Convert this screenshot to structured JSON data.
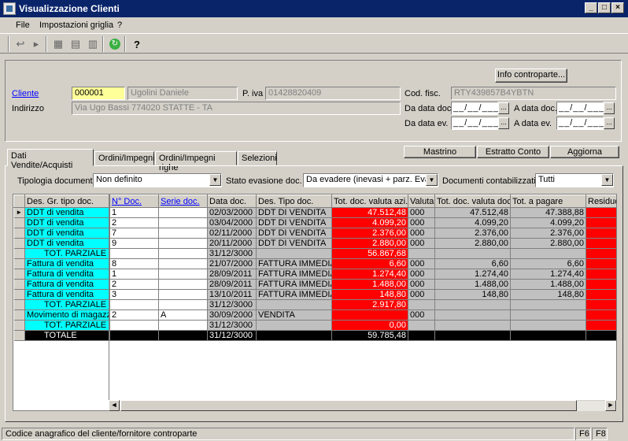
{
  "window": {
    "title": "Visualizzazione Clienti"
  },
  "menu": [
    "File",
    "Impostazioni griglia",
    "?"
  ],
  "form": {
    "cliente_label": "Cliente",
    "cliente_code": "000001",
    "cliente_name": "Ugolini Daniele",
    "piva_label": "P. iva",
    "piva_value": "01428820409",
    "codfisc_label": "Cod. fisc.",
    "codfisc_value": "RTY439857B4YBTN",
    "indirizzo_label": "Indirizzo",
    "indirizzo_value": "Via Ugo Bassi  774020  STATTE  - TA",
    "info_button": "Info controparte...",
    "da_data_doc": "Da data doc.",
    "a_data_doc": "A data doc.",
    "da_data_ev": "Da data ev.",
    "a_data_ev": "A data ev.",
    "date_placeholder": "__/__/____",
    "date_btn": "..."
  },
  "tabs": [
    "Dati Vendite/Acquisti",
    "Ordini/Impegni",
    "Ordini/Impegni righe",
    "Selezioni"
  ],
  "actions": {
    "mastrino": "Mastrino",
    "estratto": "Estratto Conto",
    "aggiorna": "Aggiorna"
  },
  "filters": {
    "tipologia_label": "Tipologia documenti",
    "tipologia_value": "Non definito",
    "stato_label": "Stato evasione doc.",
    "stato_value": "Da evadere (inevasi + parz. Evasi",
    "contab_label": "Documenti contabilizzati",
    "contab_value": "Tutti"
  },
  "grid": {
    "columns": [
      "Des. Gr. tipo doc.",
      "N° Doc.",
      "Serie doc.",
      "Data doc.",
      "Des. Tipo doc.",
      "Tot. doc. valuta azi.",
      "Valuta",
      "Tot. doc. valuta doc",
      "Tot. a pagare",
      "Residuo"
    ],
    "rows": [
      {
        "kind": "doc",
        "c": [
          "DDT di vendita",
          "1",
          "",
          "02/03/2000",
          "DDT DI VENDITA",
          "47.512,48",
          "000",
          "47.512,48",
          "47.388,88",
          ""
        ],
        "current": true
      },
      {
        "kind": "doc",
        "c": [
          "DDT di vendita",
          "2",
          "",
          "03/04/2000",
          "DDT DI VENDITA",
          "4.099,20",
          "000",
          "4.099,20",
          "4.099,20",
          ""
        ]
      },
      {
        "kind": "doc",
        "c": [
          "DDT di vendita",
          "7",
          "",
          "02/11/2000",
          "DDT DI VENDITA",
          "2.376,00",
          "000",
          "2.376,00",
          "2.376,00",
          ""
        ]
      },
      {
        "kind": "doc",
        "c": [
          "DDT di vendita",
          "9",
          "",
          "20/11/2000",
          "DDT DI VENDITA",
          "2.880,00",
          "000",
          "2.880,00",
          "2.880,00",
          ""
        ]
      },
      {
        "kind": "sub",
        "c": [
          "TOT. PARZIALE",
          "",
          "",
          "31/12/3000",
          "",
          "56.867,68",
          "",
          "",
          "",
          ""
        ]
      },
      {
        "kind": "doc",
        "c": [
          "Fattura di vendita",
          "8",
          "",
          "21/07/2000",
          "FATTURA IMMEDIA",
          "6,60",
          "000",
          "6,60",
          "6,60",
          ""
        ]
      },
      {
        "kind": "doc",
        "c": [
          "Fattura di vendita",
          "1",
          "",
          "28/09/2011",
          "FATTURA IMMEDIA",
          "1.274,40",
          "000",
          "1.274,40",
          "1.274,40",
          ""
        ]
      },
      {
        "kind": "doc",
        "c": [
          "Fattura di vendita",
          "2",
          "",
          "28/09/2011",
          "FATTURA IMMEDIA",
          "1.488,00",
          "000",
          "1.488,00",
          "1.488,00",
          ""
        ]
      },
      {
        "kind": "doc",
        "c": [
          "Fattura di vendita",
          "3",
          "",
          "13/10/2011",
          "FATTURA IMMEDIA",
          "148,80",
          "000",
          "148,80",
          "148,80",
          ""
        ]
      },
      {
        "kind": "sub",
        "c": [
          "TOT. PARZIALE",
          "",
          "",
          "31/12/3000",
          "",
          "2.917,80",
          "",
          "",
          "",
          ""
        ]
      },
      {
        "kind": "doc",
        "c": [
          "Movimento di magazzi",
          "2",
          "A",
          "30/09/2000",
          "VENDITA",
          "",
          "000",
          "",
          "",
          ""
        ]
      },
      {
        "kind": "sub",
        "c": [
          "TOT. PARZIALE",
          "",
          "",
          "31/12/3000",
          "",
          "0,00",
          "",
          "",
          "",
          ""
        ]
      },
      {
        "kind": "tot",
        "c": [
          "TOTALE",
          "",
          "",
          "31/12/3000",
          "",
          "59.785,48",
          "",
          "",
          "",
          ""
        ]
      }
    ]
  },
  "status": {
    "text": "Codice anagrafico del cliente/fornitore controparte",
    "f6": "F6",
    "f8": "F8"
  },
  "colors": {
    "titlebar": "#0a246a",
    "cyan": "#00ffff",
    "red": "#ff0000",
    "gray": "#c0c0c0"
  }
}
